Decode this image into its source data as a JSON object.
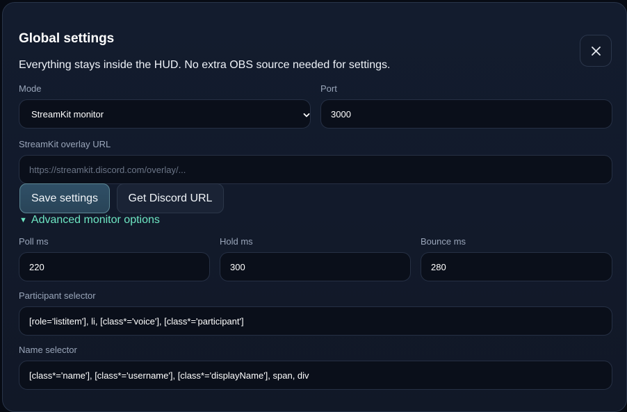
{
  "dialog": {
    "title": "Global settings",
    "subtitle": "Everything stays inside the HUD. No extra OBS source needed for settings.",
    "close_icon": "close-icon"
  },
  "form": {
    "mode": {
      "label": "Mode",
      "value": "StreamKit monitor"
    },
    "port": {
      "label": "Port",
      "value": "3000"
    },
    "overlay_url": {
      "label": "StreamKit overlay URL",
      "value": "",
      "placeholder": "https://streamkit.discord.com/overlay/..."
    }
  },
  "actions": {
    "save_label": "Save settings",
    "discord_label": "Get Discord URL"
  },
  "advanced": {
    "toggle_label": "Advanced monitor options",
    "expanded": true,
    "poll": {
      "label": "Poll ms",
      "value": "220"
    },
    "hold": {
      "label": "Hold ms",
      "value": "300"
    },
    "bounce": {
      "label": "Bounce ms",
      "value": "280"
    },
    "participant_selector": {
      "label": "Participant selector",
      "value": "[role='listitem'], li, [class*='voice'], [class*='participant']"
    },
    "name_selector": {
      "label": "Name selector",
      "value": "[class*='name'], [class*='username'], [class*='displayName'], span, div"
    }
  },
  "colors": {
    "accent": "#6ee7c3",
    "panel_bg": "#121a2b",
    "field_bg": "#0a0f1a",
    "primary_button": "#2f4f66"
  }
}
